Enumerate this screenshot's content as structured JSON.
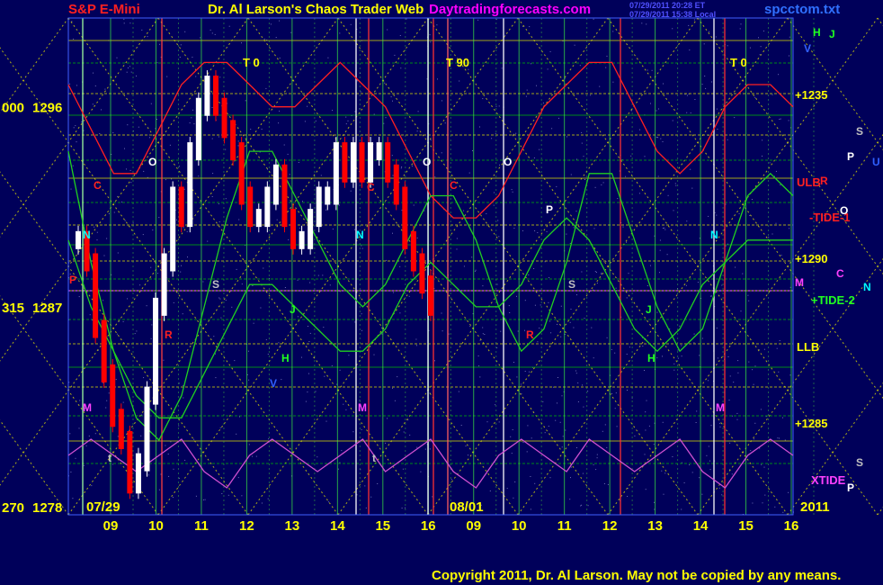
{
  "header": {
    "instrument": "S&P E-Mini",
    "title": "Dr. Al Larson's Chaos Trader Web",
    "site": "Daytradingforecasts.com",
    "timestamp_1": "07/29/2011 20:28 ET",
    "timestamp_2": "07/29/2011 15:38 Local",
    "filename": "spcctom.txt"
  },
  "footer": {
    "copyright": "Copyright 2011, Dr. Al Larson. May not be copied by any means."
  },
  "colors": {
    "background": "#00005a",
    "grid_green": "#00c000",
    "grid_yellow": "#e8e800",
    "price_up": "#ffffff",
    "price_down": "#ff0000",
    "xtide": "#d050d0",
    "axis_text": "#ffff00",
    "title_red": "#ff2020",
    "site_magenta": "#ff00ff"
  },
  "chart_data": {
    "type": "line",
    "title": "S&P E-Mini",
    "ylim": [
      1278,
      1300
    ],
    "y_ticks": [
      {
        "left": "000",
        "value": 1296,
        "label": "1296"
      },
      {
        "left": "315",
        "value": 1287,
        "label": "1287"
      },
      {
        "left": "270",
        "value": 1278,
        "label": "1278"
      }
    ],
    "x_ticks": [
      "09",
      "10",
      "11",
      "12",
      "13",
      "14",
      "15",
      "16",
      "09",
      "10",
      "11",
      "12",
      "13",
      "14",
      "15",
      "16"
    ],
    "date_labels": [
      "07/29",
      "08/01",
      "2011"
    ],
    "tide_markers": [
      "T 0",
      "T 90",
      "T 0"
    ],
    "right_labels": [
      "+1235",
      "ULB",
      "-TIDE-1",
      "+1290",
      "+TIDE-2",
      "LLB",
      "+1285",
      "XTIDE"
    ],
    "planet_letters": [
      "H",
      "J",
      "V",
      "S",
      "P",
      "U",
      "R",
      "O",
      "C",
      "N",
      "M",
      "S",
      "P"
    ],
    "chart_letters": [
      "O",
      "O",
      "O",
      "C",
      "C",
      "C",
      "N",
      "N",
      "N",
      "R",
      "R",
      "S",
      "S",
      "J",
      "J",
      "H",
      "H",
      "V",
      "M",
      "M",
      "M",
      "P",
      "P",
      "t",
      "t"
    ],
    "series": [
      {
        "name": "S&P E-Mini",
        "kind": "price",
        "values": [
          1290,
          1289,
          1286,
          1284,
          1282,
          1281,
          1279,
          1280,
          1283,
          1287,
          1289,
          1292,
          1291,
          1294,
          1296,
          1297,
          1296,
          1295,
          1294,
          1292,
          1291,
          1291,
          1292,
          1293,
          1291,
          1290,
          1290,
          1291,
          1292,
          1292,
          1294,
          1293,
          1294,
          1293,
          1294,
          1294,
          1293,
          1292,
          1290,
          1289,
          1288,
          1287
        ]
      },
      {
        "name": "ULB",
        "kind": "line",
        "values": [
          1297,
          1295,
          1293,
          1293,
          1295,
          1297,
          1298,
          1298,
          1297,
          1296,
          1296,
          1297,
          1298,
          1297,
          1296,
          1294,
          1292,
          1291,
          1291,
          1292,
          1294,
          1296,
          1297,
          1298,
          1298,
          1296,
          1294,
          1293,
          1294,
          1296,
          1297,
          1297,
          1296
        ]
      },
      {
        "name": "+TIDE-2",
        "kind": "line",
        "values": [
          1294,
          1289,
          1285,
          1282,
          1281,
          1283,
          1287,
          1291,
          1294,
          1294,
          1292,
          1290,
          1288,
          1287,
          1288,
          1290,
          1292,
          1292,
          1290,
          1287,
          1285,
          1286,
          1289,
          1293,
          1293,
          1290,
          1287,
          1285,
          1286,
          1289,
          1292,
          1293,
          1292
        ]
      },
      {
        "name": "LLB",
        "kind": "line",
        "values": [
          1290,
          1287,
          1285,
          1283,
          1282,
          1282,
          1284,
          1286,
          1288,
          1288,
          1287,
          1286,
          1285,
          1285,
          1286,
          1288,
          1289,
          1288,
          1287,
          1287,
          1288,
          1290,
          1291,
          1290,
          1288,
          1286,
          1285,
          1286,
          1288,
          1289,
          1290,
          1290,
          1290
        ]
      },
      {
        "name": "XTIDE",
        "kind": "line",
        "values": [
          1280,
          1279,
          1280,
          1281,
          1280,
          1279,
          1281,
          1282,
          1280,
          1279,
          1280,
          1281,
          1280,
          1279,
          1281,
          1280,
          1279,
          1281,
          1282,
          1280,
          1279,
          1280,
          1281,
          1279,
          1280,
          1281,
          1280,
          1279,
          1281,
          1282,
          1280,
          1279,
          1280
        ]
      }
    ]
  }
}
